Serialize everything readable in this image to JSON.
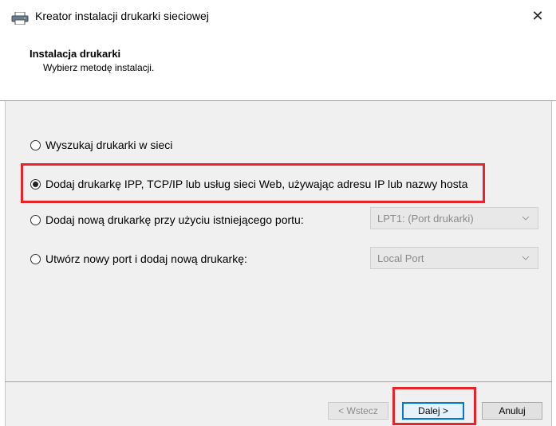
{
  "window": {
    "title": "Kreator instalacji drukarki sieciowej",
    "close_glyph": "✕"
  },
  "header": {
    "title": "Instalacja drukarki",
    "subtitle": "Wybierz metodę instalacji."
  },
  "options": [
    {
      "label": "Wyszukaj drukarki w sieci",
      "selected": false
    },
    {
      "label": "Dodaj drukarkę IPP, TCP/IP lub usług sieci Web, używając adresu IP lub nazwy hosta",
      "selected": true
    },
    {
      "label": "Dodaj nową drukarkę przy użyciu istniejącego portu:",
      "selected": false
    },
    {
      "label": "Utwórz nowy port i dodaj nową drukarkę:",
      "selected": false
    }
  ],
  "combos": {
    "existing_port": {
      "value": "LPT1: (Port drukarki)"
    },
    "new_port": {
      "value": "Local Port"
    }
  },
  "buttons": {
    "back": "< Wstecz",
    "next": "Dalej >",
    "cancel": "Anuluj"
  },
  "colors": {
    "highlight": "#e8232a",
    "focus": "#0078d7"
  },
  "icons": {
    "title_icon": "printer-icon",
    "combo_arrow": "chevron-down-icon"
  }
}
